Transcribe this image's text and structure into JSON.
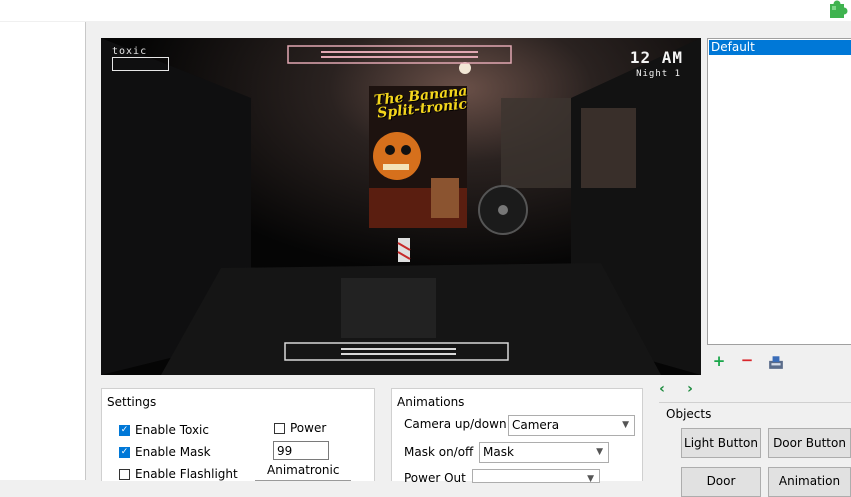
{
  "preview": {
    "toxic_label": "toxic",
    "time": "12 AM",
    "night": "Night 1",
    "poster_title": "The Banana Split-tronic"
  },
  "list": {
    "items": [
      {
        "label": "Default",
        "selected": true
      }
    ]
  },
  "list_tools": {
    "add_icon": "plus-icon",
    "remove_icon": "minus-icon",
    "export_icon": "export-icon"
  },
  "nav": {
    "prev_icon": "chevron-left-icon",
    "next_icon": "chevron-right-icon"
  },
  "settings": {
    "title": "Settings",
    "enable_toxic": {
      "label": "Enable Toxic",
      "checked": true
    },
    "enable_mask": {
      "label": "Enable Mask",
      "checked": true
    },
    "enable_flashlight": {
      "label": "Enable Flashlight",
      "checked": false
    },
    "power": {
      "label": "Power",
      "checked": false
    },
    "power_value": "99",
    "animatronic_label": "Animatronic"
  },
  "animations": {
    "title": "Animations",
    "camera_label": "Camera up/down",
    "camera_value": "Camera",
    "mask_label": "Mask on/off",
    "mask_value": "Mask",
    "power_out_label": "Power Out"
  },
  "objects": {
    "title": "Objects",
    "buttons": [
      "Light Button",
      "Door Button",
      "Door",
      "Animation"
    ]
  },
  "colors": {
    "accent": "#0078d7",
    "nav_green": "#1a8a3c",
    "add_green": "#1aa64a",
    "remove_red": "#d9262b"
  }
}
